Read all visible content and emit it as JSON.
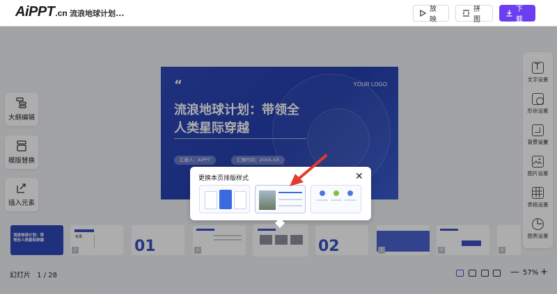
{
  "header": {
    "logo_main": "AiPPT",
    "logo_suffix": ".cn",
    "doc_title": "流浪地球计划...",
    "play_label": "放映",
    "split_label": "拼图",
    "download_label": "下载"
  },
  "left_tools": [
    {
      "label": "大纲编辑",
      "icon": "outline-icon"
    },
    {
      "label": "模版替换",
      "icon": "template-icon"
    },
    {
      "label": "插入元素",
      "icon": "insert-icon"
    }
  ],
  "right_tools": [
    {
      "label": "文字设置",
      "icon": "text-icon"
    },
    {
      "label": "形状设置",
      "icon": "shape-icon"
    },
    {
      "label": "背景设置",
      "icon": "background-icon"
    },
    {
      "label": "图片设置",
      "icon": "image-icon"
    },
    {
      "label": "表格设置",
      "icon": "table-icon"
    },
    {
      "label": "图表设置",
      "icon": "chart-icon"
    }
  ],
  "slide": {
    "quote": "“",
    "your_logo": "YOUR LOGO",
    "title_line1": "流浪地球计划：带领全",
    "title_line2": "人类星际穿越",
    "reporter": "汇报人：AiPPT",
    "time": "汇报时间：20XX.XX"
  },
  "popup": {
    "title": "更换本页排版样式",
    "close": "✕"
  },
  "thumbnails": {
    "t1_title": "流浪地球计划：带领全人类星际穿越",
    "t2_label": "目录",
    "t3_big": "01",
    "t6_big": "02",
    "numbers": [
      "",
      "2",
      "",
      "4",
      "",
      "",
      "7",
      "8",
      "9"
    ]
  },
  "status": {
    "slide_label": "幻灯片",
    "slide_count": "1 / 28",
    "zoom": "57%",
    "zoom_minus": "—",
    "zoom_plus": "+"
  },
  "colors": {
    "accent": "#6b3ff0",
    "slide_blue": "#2f48b8",
    "arrow_red": "#e53a2f"
  }
}
